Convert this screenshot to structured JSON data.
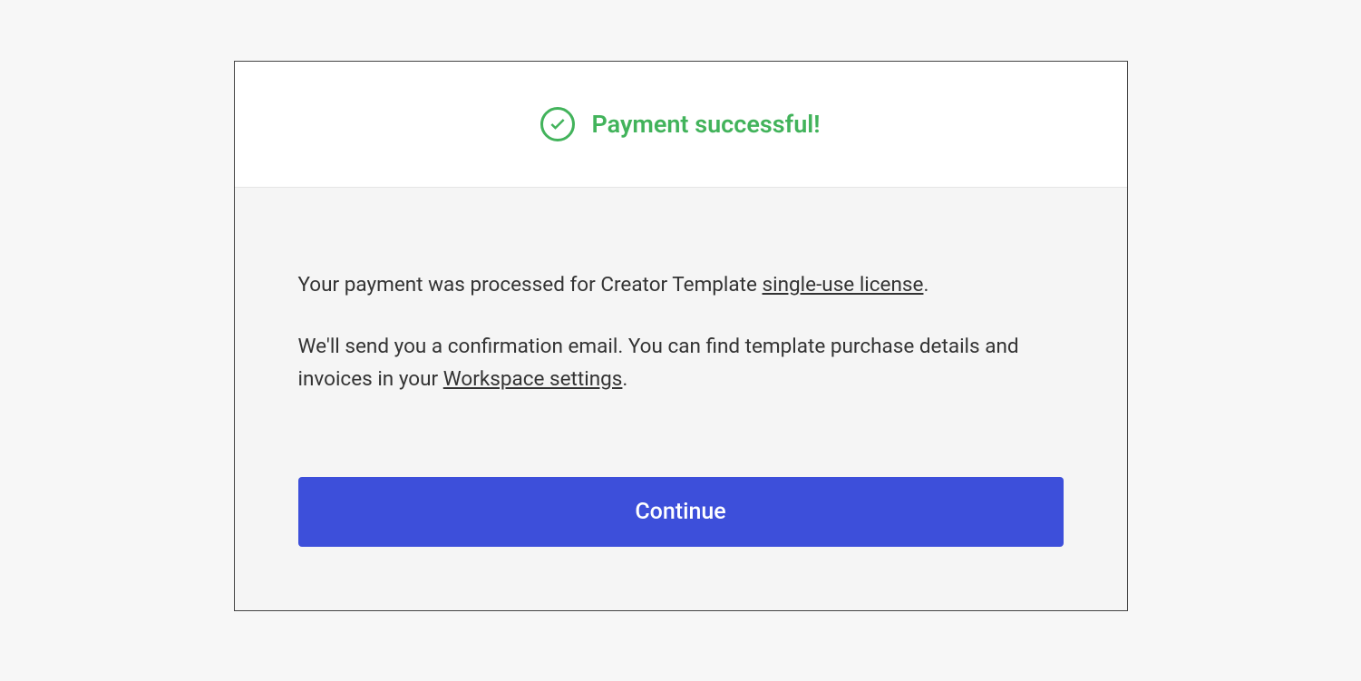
{
  "header": {
    "title": "Payment successful!"
  },
  "body": {
    "line1_prefix": "Your payment was processed for Creator Template ",
    "line1_link": "single-use license",
    "line1_suffix": ".",
    "line2_prefix": "We'll send you a confirmation email. You can find template purchase details and invoices in your ",
    "line2_link": "Workspace settings",
    "line2_suffix": "."
  },
  "button": {
    "continue_label": "Continue"
  }
}
